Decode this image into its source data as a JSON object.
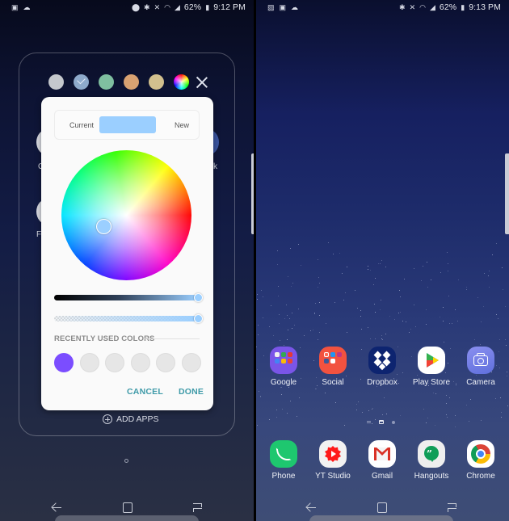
{
  "left": {
    "status_bar": {
      "left_icons": [
        "sd-card-icon",
        "cloud-icon"
      ],
      "right_icons": [
        "location-icon",
        "bluetooth-icon",
        "mute-icon",
        "wifi-icon",
        "signal-icon"
      ],
      "battery": "62%",
      "time": "9:12 PM"
    },
    "folder_colors": [
      {
        "name": "gray",
        "color": "#c5c8cd",
        "selected": false
      },
      {
        "name": "blue-gray",
        "color": "#8eaacb",
        "selected": true
      },
      {
        "name": "green",
        "color": "#7fbfa0",
        "selected": false
      },
      {
        "name": "orange",
        "color": "#d9a272",
        "selected": false
      },
      {
        "name": "tan",
        "color": "#d2c08e",
        "selected": false
      },
      {
        "name": "custom",
        "color": "rainbow",
        "selected": false
      }
    ],
    "peek_labels": {
      "left_top": "G",
      "left_bottom": "F",
      "right_top": "k"
    },
    "color_picker": {
      "current_label": "Current",
      "new_label": "New",
      "current_color": "#9bcfff",
      "brightness": 1.0,
      "opacity": 1.0,
      "recent_title": "RECENTLY USED COLORS",
      "recent_colors": [
        "#7b4dff",
        "",
        "",
        "",
        "",
        ""
      ],
      "cancel_label": "CANCEL",
      "done_label": "DONE",
      "accent_color": "#3e9aa8"
    },
    "add_apps_label": "ADD APPS"
  },
  "right": {
    "status_bar": {
      "left_icons": [
        "image-icon",
        "sd-card-icon",
        "cloud-icon"
      ],
      "right_icons": [
        "bluetooth-icon",
        "mute-icon",
        "wifi-icon",
        "signal-icon"
      ],
      "battery": "62%",
      "time": "9:13 PM"
    },
    "apps_row": [
      {
        "label": "Google",
        "icon": "google-folder-icon"
      },
      {
        "label": "Social",
        "icon": "social-folder-icon"
      },
      {
        "label": "Dropbox",
        "icon": "dropbox-icon"
      },
      {
        "label": "Play Store",
        "icon": "play-store-icon"
      },
      {
        "label": "Camera",
        "icon": "camera-icon"
      }
    ],
    "dock": [
      {
        "label": "Phone",
        "icon": "phone-icon"
      },
      {
        "label": "YT Studio",
        "icon": "yt-studio-icon"
      },
      {
        "label": "Gmail",
        "icon": "gmail-icon"
      },
      {
        "label": "Hangouts",
        "icon": "hangouts-icon"
      },
      {
        "label": "Chrome",
        "icon": "chrome-icon"
      }
    ],
    "page_indicator": {
      "pages": [
        "menu",
        "home",
        "page"
      ],
      "active": 1
    }
  }
}
